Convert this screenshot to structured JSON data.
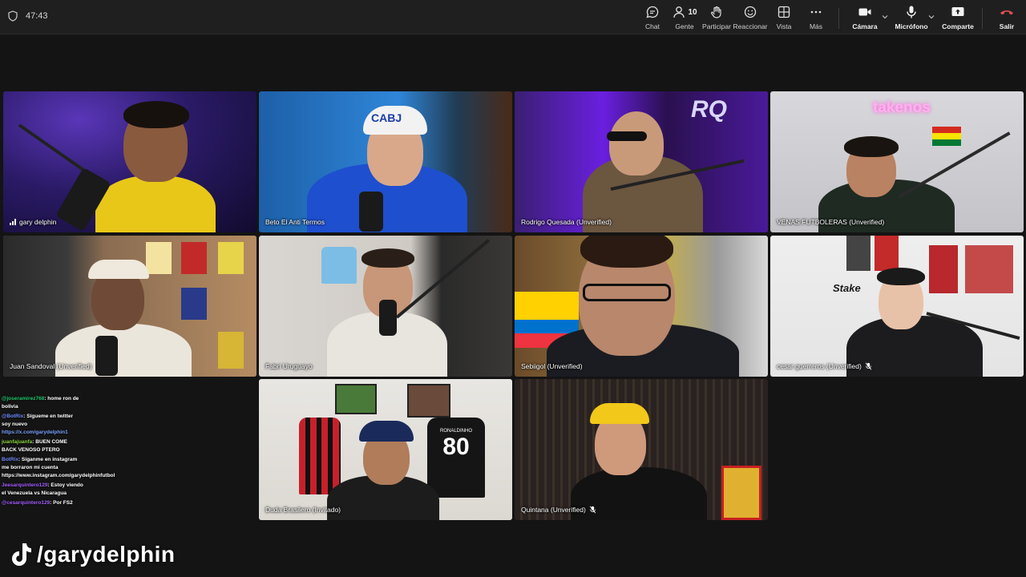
{
  "meeting": {
    "timer": "47:43"
  },
  "toolbar": {
    "chat": "Chat",
    "people": "Gente",
    "people_count": "10",
    "raise": "Participar",
    "react": "Reaccionar",
    "view": "Vista",
    "more": "Más",
    "camera": "Cámara",
    "mic": "Micrófono",
    "share": "Comparte",
    "leave": "Salir"
  },
  "participants": [
    {
      "name": "gary delphin"
    },
    {
      "name": "Beto El Anti Termos"
    },
    {
      "name": "Rodrigo Quesada (Unverified)"
    },
    {
      "name": "VENAS FUTBOLERAS (Unverified)"
    },
    {
      "name": "Juan Sandoval (Unverified)"
    },
    {
      "name": "Fabri Uruguayo"
    },
    {
      "name": "Sebiigol (Unverified)"
    },
    {
      "name": "cesar guerreros (Unverified)"
    },
    {
      "name": "Duda Brasilero (Invitado)"
    },
    {
      "name": "Quintana (Unverified)"
    }
  ],
  "scene_text": {
    "cap": "CABJ",
    "logo": "RQ",
    "takenos": "takenos",
    "stake": "Stake",
    "jersey": "80",
    "jersey_name": "RONALDINHO"
  },
  "chat": [
    {
      "user": "@joseramirez768",
      "text": ": home ron de bolivia"
    },
    {
      "user": "@BotRix",
      "text": ": Sígueme en twitter soy nuevo ",
      "link": "https://x.com/garydelphin1"
    },
    {
      "user": "juanfajuanfa",
      "text": ": BUEN COME BACK VENOSO PTERO"
    },
    {
      "user": "BotRix",
      "text": ": Síganme en instagram me borraron mi cuenta ",
      "link": "https://www.instagram.com/garydelphinfutbol"
    },
    {
      "user": "Jeesarquintero129",
      "text": ": Estoy viendo el Venezuela vs Nicaragua"
    },
    {
      "user": "@cesarquintero129",
      "text": ": Por FS2"
    }
  ],
  "watermark": {
    "handle": "/garydelphin"
  }
}
